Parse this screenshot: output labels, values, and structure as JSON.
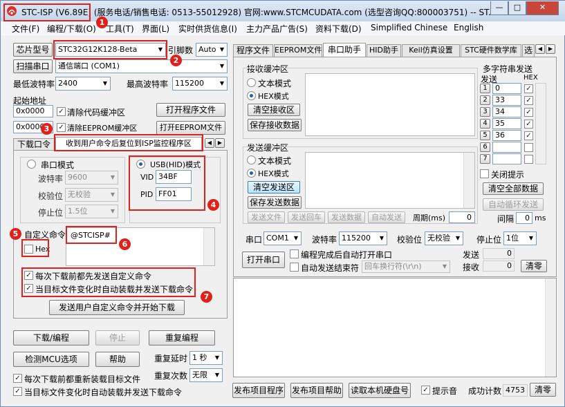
{
  "window": {
    "title": "STC-ISP (V6.89E) (服务电话/销售电话: 0513-55012928) 官网:www.STCMCUDATA.com  (选型咨询QQ:800003751) -- ST...",
    "minimize": "—",
    "maximize": "□",
    "close": "✕"
  },
  "menu": [
    "文件(F)",
    "编程/下载(O)",
    "工具(T)",
    "界面(L)",
    "实时供货信息(I)",
    "主力产品广告(S)",
    "资料下载(D)",
    "Simplified Chinese",
    "English"
  ],
  "left": {
    "chip_type_btn": "芯片型号",
    "chip_type": "STC32G12K128-Beta",
    "pin_label": "引脚数",
    "pin_value": "Auto",
    "scan_btn": "扫描串口",
    "port": "通信端口 (COM1)",
    "min_baud_label": "最低波特率",
    "min_baud": "2400",
    "max_baud_label": "最高波特率",
    "max_baud": "115200",
    "start_addr_label": "起始地址",
    "addr1": "0x0000",
    "clear_code": "清除代码缓冲区",
    "open_prog_btn": "打开程序文件",
    "addr2": "0x0000",
    "clear_eeprom": "清除EEPROM缓冲区",
    "open_eeprom_btn": "打开EEPROM文件",
    "tabs": [
      "下载口令",
      "收到用户命令后复位到ISP监控程序区"
    ],
    "serial_mode": "串口模式",
    "usb_mode": "USB(HID)模式",
    "baud_label": "波特率",
    "baud": "9600",
    "parity_label": "校验位",
    "parity": "无校验",
    "stop_label": "停止位",
    "stop": "1.5位",
    "vid_label": "VID",
    "vid": "34BF",
    "pid_label": "PID",
    "pid": "FF01",
    "custom_cmd_label": "自定义命令",
    "hex_label": "Hex",
    "custom_cmd": "@STCISP#",
    "opt1": "每次下载前都先发送自定义命令",
    "opt2": "当目标文件变化时自动装载并发送下载命令",
    "send_cmd_btn": "发送用户自定义命令并开始下载",
    "download_btn": "下载/编程",
    "stop_btn": "停止",
    "reprogram_btn": "重复编程",
    "check_mcu_btn": "检测MCU选项",
    "help_btn": "帮助",
    "repeat_delay_label": "重复延时",
    "repeat_delay": "1 秒",
    "repeat_count_label": "重复次数",
    "repeat_count": "无限",
    "reload_opt": "每次下载前都重新装载目标文件",
    "auto_load_opt": "当目标文件变化时自动装载并发送下载命令"
  },
  "right": {
    "tabs": [
      "程序文件",
      "EEPROM文件",
      "串口助手",
      "HID助手",
      "Keil仿真设置",
      "STC硬件数学库",
      "选"
    ],
    "recv_label": "接收缓冲区",
    "text_mode": "文本模式",
    "hex_mode": "HEX模式",
    "clear_recv": "清空接收区",
    "save_recv": "保存接收数据",
    "send_label": "发送缓冲区",
    "clear_send": "清空发送区",
    "save_send": "保存发送数据",
    "send_file": "发送文件",
    "send_enter": "发送回车",
    "send_data": "发送数据",
    "auto_send": "自动发送",
    "period_label": "周期(ms)",
    "period": "0",
    "multi_label": "多字符串发送",
    "send_col": "发送",
    "hex_col": "HEX",
    "multi": [
      {
        "n": "1",
        "v": "0"
      },
      {
        "n": "2",
        "v": "33"
      },
      {
        "n": "3",
        "v": "34"
      },
      {
        "n": "4",
        "v": "35"
      },
      {
        "n": "5",
        "v": "36"
      },
      {
        "n": "6",
        "v": ""
      },
      {
        "n": "7",
        "v": ""
      }
    ],
    "close_hint": "关闭提示",
    "clear_all": "清空全部数据",
    "auto_loop": "自动循环发送",
    "interval_label": "间隔",
    "interval": "0",
    "interval_unit": "ms",
    "port_label": "串口",
    "port": "COM1",
    "baud_label": "波特率",
    "baud": "115200",
    "parity_label": "校验位",
    "parity": "无校验",
    "stop_label": "停止位",
    "stop": "1位",
    "open_port": "打开串口",
    "auto_open": "编程完成后自动打开串口",
    "auto_end": "自动发送结束符",
    "end_char": "回车换行符(\\r\\n)",
    "send_count_label": "发送",
    "send_count": "0",
    "recv_count_label": "接收",
    "recv_count": "0",
    "clear_btn": "清零",
    "publish_prog": "发布项目程序",
    "publish_help": "发布项目帮助",
    "read_disk": "读取本机硬盘号",
    "sound": "提示音",
    "success_label": "成功计数",
    "success_count": "4753",
    "clear_btn2": "清零"
  },
  "badges": [
    "1",
    "2",
    "3",
    "4",
    "5",
    "6",
    "7"
  ]
}
